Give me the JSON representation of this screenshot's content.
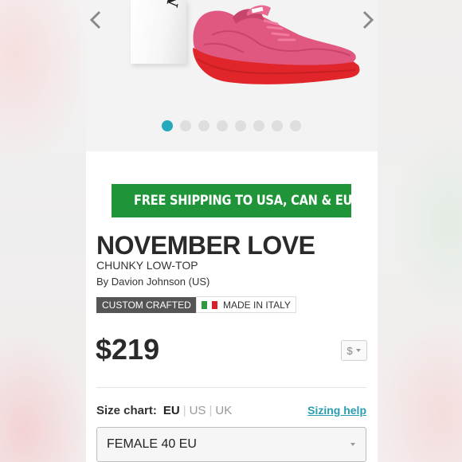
{
  "gallery": {
    "box_text": "Nove",
    "slide_count": 8,
    "active_slide": 1
  },
  "banner": {
    "text": "FREE SHIPPING TO USA, CAN & EU",
    "icon": "airplane-icon"
  },
  "product": {
    "title": "NOVEMBER LOVE",
    "subtitle": "CHUNKY LOW-TOP",
    "author": "By Davion Johnson (US)",
    "badge_custom": "CUSTOM CRAFTED",
    "badge_origin": "MADE IN ITALY",
    "price": "$219",
    "currency": "$"
  },
  "size": {
    "label": "Size chart:",
    "units": [
      "EU",
      "US",
      "UK"
    ],
    "active_unit": "EU",
    "help_link": "Sizing help",
    "selected": "FEMALE 40 EU"
  },
  "colors": {
    "accent": "#27a9bd",
    "banner_green": "#1f9438",
    "shoe_upper": "#e0577f",
    "shoe_sole": "#e0262b"
  }
}
